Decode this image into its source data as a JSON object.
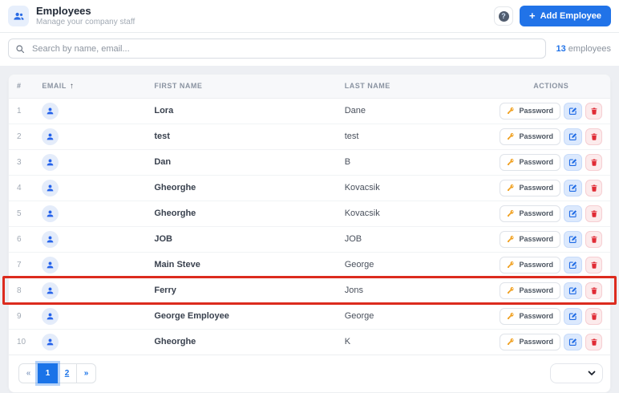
{
  "app": {
    "title": "Employees",
    "subtitle": "Manage your company staff",
    "help_glyph": "?",
    "add_employee": {
      "plus": "+",
      "label": "Add Employee"
    }
  },
  "search": {
    "placeholder": "Search by name, email...",
    "count": "13",
    "count_label": "employees"
  },
  "table": {
    "headers": {
      "index": "#",
      "email": "EMAIL",
      "first_name": "FIRST NAME",
      "last_name": "LAST NAME",
      "actions": "ACTIONS"
    },
    "sort": {
      "column": "EMAIL",
      "direction": "asc",
      "glyph": "↑"
    },
    "actions": {
      "password_label": "Password"
    },
    "rows": [
      {
        "num": "1",
        "first": "Lora",
        "last": "Dane",
        "highlighted": false
      },
      {
        "num": "2",
        "first": "test",
        "last": "test",
        "highlighted": false
      },
      {
        "num": "3",
        "first": "Dan",
        "last": "B",
        "highlighted": false
      },
      {
        "num": "4",
        "first": "Gheorghe",
        "last": "Kovacsik",
        "highlighted": false
      },
      {
        "num": "5",
        "first": "Gheorghe",
        "last": "Kovacsik",
        "highlighted": false
      },
      {
        "num": "6",
        "first": "JOB",
        "last": "JOB",
        "highlighted": false
      },
      {
        "num": "7",
        "first": "Main Steve",
        "last": "George",
        "highlighted": false
      },
      {
        "num": "8",
        "first": "Ferry",
        "last": "Jons",
        "highlighted": true
      },
      {
        "num": "9",
        "first": "George Employee",
        "last": "George",
        "highlighted": false
      },
      {
        "num": "10",
        "first": "Gheorghe",
        "last": "K",
        "highlighted": false
      }
    ]
  },
  "pagination": {
    "first": "«",
    "pages": [
      "1",
      "2"
    ],
    "active": "1",
    "last": "»"
  },
  "page_size_select": {
    "value": ""
  },
  "colors": {
    "accent": "#2173e8",
    "active_page": "#1a73e8",
    "highlight_border": "#dc2b1e",
    "key_icon": "#f0a020",
    "edit_icon": "#1d6ae5",
    "delete_icon": "#e02b35"
  }
}
